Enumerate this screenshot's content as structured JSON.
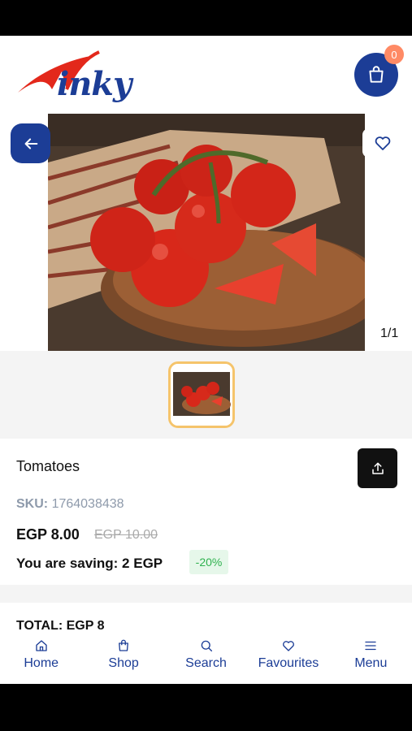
{
  "header": {
    "logo_text": "inky",
    "cart_count": "0"
  },
  "gallery": {
    "counter": "1/1"
  },
  "product": {
    "title": "Tomatoes",
    "sku_label": "SKU:",
    "sku_value": "1764038438",
    "price": "EGP 8.00",
    "old_price": "EGP 10.00",
    "saving": "You are saving: 2 EGP",
    "discount": "-20%",
    "total": "TOTAL: EGP 8"
  },
  "nav": {
    "items": [
      {
        "label": "Home",
        "icon": "home-icon"
      },
      {
        "label": "Shop",
        "icon": "bag-icon"
      },
      {
        "label": "Search",
        "icon": "search-icon"
      },
      {
        "label": "Favourites",
        "icon": "heart-icon"
      },
      {
        "label": "Menu",
        "icon": "menu-icon"
      }
    ]
  },
  "colors": {
    "brand": "#1c3d96",
    "accent": "#f5c46b",
    "logo_swoosh": "#e3281b",
    "badge": "#ff8a65",
    "discount_text": "#2fb24f"
  }
}
